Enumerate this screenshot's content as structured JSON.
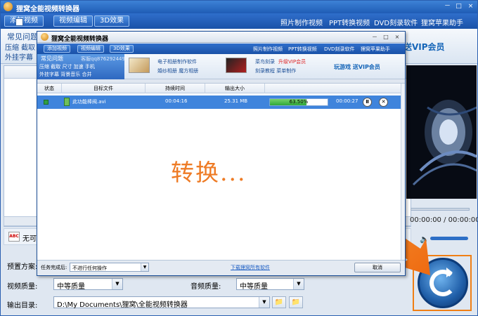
{
  "outer": {
    "title": "狸窝全能视频转换器",
    "window_buttons": [
      "－",
      "□",
      "×"
    ],
    "tabs": [
      "添加视频",
      "视频编辑",
      "3D效果"
    ],
    "links": [
      "照片制作视频",
      "PPT转换视频",
      "DVD刻录软件",
      "狸窝苹果助手"
    ],
    "faq_title": "常见问题",
    "faq_line1": "压缩 截取",
    "faq_line2": "外挂字幕",
    "vip": "送VIP会员",
    "time": "00:00:00 / 00:00:00",
    "rename_label": "无可",
    "abc_icon": "ABC",
    "preset_label": "预置方案:",
    "video_quality_label": "视频质量:",
    "video_quality_value": "中等质量",
    "audio_quality_label": "音频质量:",
    "audio_quality_value": "中等质量",
    "output_label": "输出目录:",
    "output_path": "D:\\My Documents\\狸窝\\全能视频转换器",
    "folder_icon": "📁"
  },
  "dialog": {
    "title": "狸窝全能视频转换器",
    "window_buttons": [
      "－",
      "□",
      "×"
    ],
    "tabs": [
      "添加视频",
      "视频编辑",
      "3D效果"
    ],
    "links": [
      "照片制作视频",
      "PPT转换视频",
      "DVD刻录软件",
      "狸窝苹果助手"
    ],
    "faq_title": "常见问题",
    "faq_qq": "客服qq876292449",
    "faq_line1": "压缩 截取 尺寸 加速 手机",
    "faq_line2": "外挂字幕 背景音乐 合并",
    "promo1_line1": "电子相册制作软件",
    "promo1_line2": "婚纱相册 魔方相册",
    "promo2_line1a": "菜鸟刻录",
    "promo2_line1b": "升级VIP会员",
    "promo2_line2": "刻录教程 菜单制作",
    "vip": "玩游戏 送VIP会员",
    "columns": [
      "状态",
      "目标文件",
      "持续时间",
      "输出大小"
    ],
    "row": {
      "file": "此功能棒阀.avi",
      "duration": "00:04:16",
      "size": "25.31 MB",
      "progress_percent": 63.5,
      "progress_text": "63.50%",
      "elapsed": "00:00:27",
      "pause_icon": "Ⅱ",
      "remove_icon": "✕"
    },
    "converting_text": "转换...",
    "after_label": "任务完成后:",
    "after_value": "不进行任何操作",
    "download_link": "下载狸窝所有软件",
    "cancel_button": "取消"
  },
  "colors": {
    "accent_blue": "#2f6ecb",
    "row_selected": "#3f84dc",
    "progress_green": "#2ea83a",
    "annotation_orange": "#f07f15"
  }
}
